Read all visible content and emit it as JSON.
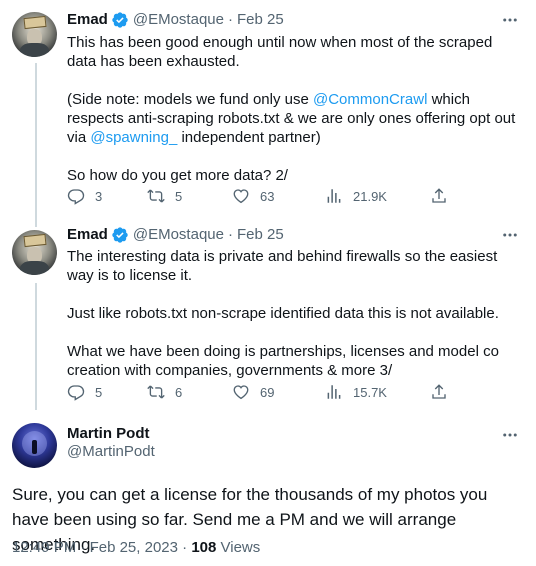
{
  "tweets": [
    {
      "name": "Emad",
      "handle": "@EMostaque",
      "dot": "·",
      "date": "Feb 25",
      "paragraphs": [
        [
          "This has been good enough until now when most of the scraped data has been exhausted."
        ],
        [
          "(Side note: models we fund only use ",
          "@CommonCrawl",
          " which respects anti-scraping robots.txt & we are only ones offering opt out via ",
          "@spawning_",
          " independent partner)"
        ],
        [
          "So how do you get more data? 2/"
        ]
      ],
      "actions": {
        "replies": "3",
        "retweets": "5",
        "likes": "63",
        "views": "21.9K"
      }
    },
    {
      "name": "Emad",
      "handle": "@EMostaque",
      "dot": "·",
      "date": "Feb 25",
      "paragraphs": [
        "The interesting data is private and behind firewalls so the easiest way is to license it.",
        "Just like robots.txt non-scrape identified data this is not available.",
        "What we have been doing is partnerships, licenses and model co creation with companies, governments & more 3/"
      ],
      "actions": {
        "replies": "5",
        "retweets": "6",
        "likes": "69",
        "views": "15.7K"
      }
    }
  ],
  "main_tweet": {
    "name": "Martin Podt",
    "handle": "@MartinPodt",
    "text": "Sure, you can get a license for the thousands of my photos you have been using so far. Send me a PM and we will arrange something.",
    "time": "12:49 PM",
    "dot": "·",
    "date": "Feb 25, 2023",
    "views_count": "108",
    "views_label": "Views"
  },
  "icons": {
    "more": "more-horizontal-icon",
    "reply": "reply-icon",
    "retweet": "retweet-icon",
    "like": "heart-icon",
    "views": "analytics-icon",
    "share": "share-icon",
    "verified": "verified-badge-icon"
  },
  "colors": {
    "accent": "#1d9bf0",
    "secondary_text": "#536471",
    "primary_text": "#0f1419",
    "thread_line": "#cfd9de"
  }
}
